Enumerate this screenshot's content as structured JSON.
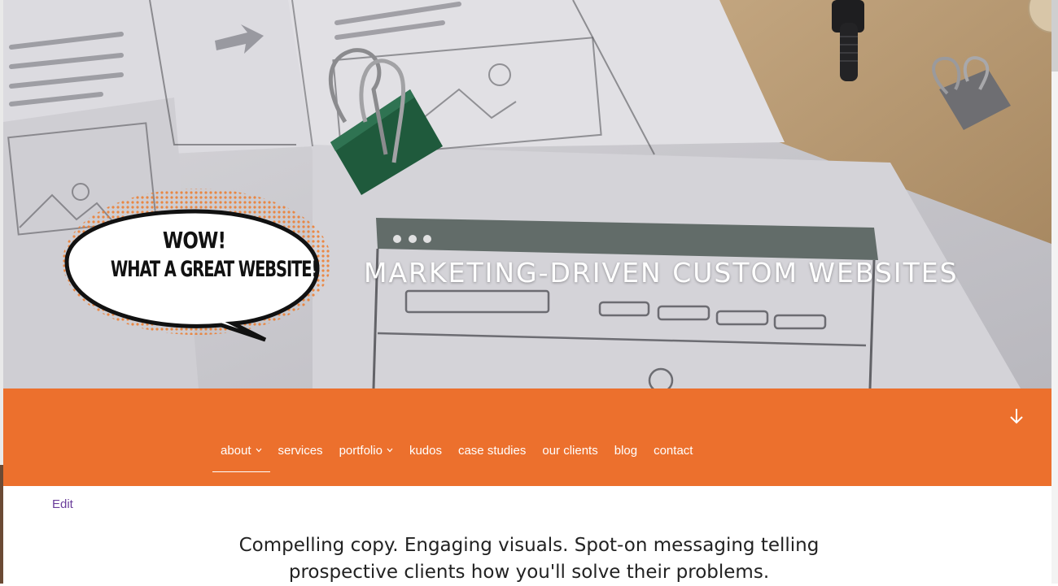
{
  "hero": {
    "speech_bubble": {
      "line1": "WOW!",
      "line2": "WHAT A GREAT WEBSITE!"
    },
    "title": "MARKETING-DRIVEN CUSTOM WEBSITES"
  },
  "nav": {
    "items": [
      {
        "label": "about",
        "has_dropdown": true,
        "active": true
      },
      {
        "label": "services",
        "has_dropdown": false
      },
      {
        "label": "portfolio",
        "has_dropdown": true
      },
      {
        "label": "kudos",
        "has_dropdown": false
      },
      {
        "label": "case studies",
        "has_dropdown": false
      },
      {
        "label": "our clients",
        "has_dropdown": false
      },
      {
        "label": "blog",
        "has_dropdown": false
      },
      {
        "label": "contact",
        "has_dropdown": false
      }
    ],
    "scroll_icon": "arrow-down-icon"
  },
  "content": {
    "edit_label": "Edit",
    "tagline_line1": "Compelling copy. Engaging visuals. Spot-on messaging telling",
    "tagline_line2": "prospective clients how you'll solve their problems."
  },
  "colors": {
    "nav_band": "#ec702d",
    "edit_link": "#6a3d9a",
    "text": "#222222"
  }
}
